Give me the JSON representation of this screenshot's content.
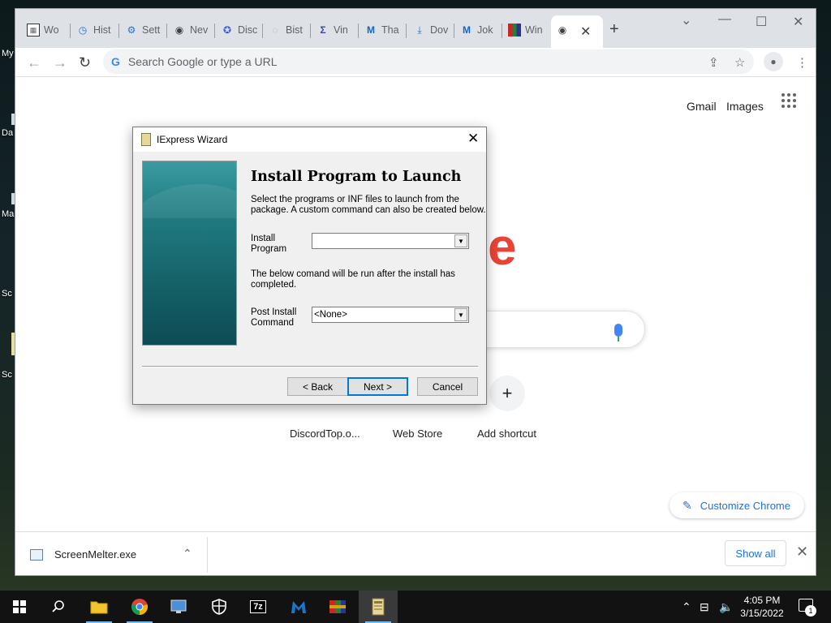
{
  "desktop": {
    "icons": [
      "My",
      "Da",
      "Ma",
      "Sc",
      "Sc"
    ]
  },
  "chrome": {
    "tabs": [
      {
        "label": "Wo",
        "icon": "sheets-icon"
      },
      {
        "label": "Hist",
        "icon": "history-icon"
      },
      {
        "label": "Sett",
        "icon": "settings-icon"
      },
      {
        "label": "Nev",
        "icon": "chrome-icon"
      },
      {
        "label": "Disc",
        "icon": "discord-icon"
      },
      {
        "label": "Bist",
        "icon": "bistro-icon"
      },
      {
        "label": "Vin",
        "icon": "sigma-icon"
      },
      {
        "label": "Tha",
        "icon": "malwarebytes-icon"
      },
      {
        "label": "Dov",
        "icon": "download-icon"
      },
      {
        "label": "Jok",
        "icon": "malwarebytes-icon"
      },
      {
        "label": "Win",
        "icon": "winrar-icon"
      }
    ],
    "active_tab_icon": "chrome-icon",
    "omnibox_placeholder": "Search Google or type a URL",
    "ntp": {
      "gmail": "Gmail",
      "images": "Images",
      "logo_letter": "e",
      "shortcuts": [
        "DiscordTop.o...",
        "Web Store",
        "Add shortcut"
      ],
      "customize": "Customize Chrome"
    },
    "download": {
      "filename": "ScreenMelter.exe",
      "show_all": "Show all"
    }
  },
  "dialog": {
    "title": "IExpress Wizard",
    "heading": "Install Program to Launch",
    "intro_line1": "Select the programs or INF files to launch from the",
    "intro_line2": "package.  A custom command can also be created below.",
    "install_label1": "Install",
    "install_label2": "Program",
    "install_value": "",
    "after_line1": "The below comand will be run after the install has",
    "after_line2": "completed.",
    "post_label1": "Post Install",
    "post_label2": "Command",
    "post_value": "<None>",
    "back": "< Back",
    "next": "Next >",
    "cancel": "Cancel"
  },
  "taskbar": {
    "apps": [
      "start-icon",
      "search-icon",
      "file-explorer-icon",
      "chrome-icon",
      "control-panel-icon",
      "windows-security-icon",
      "7zip-icon",
      "malwarebytes-icon",
      "winrar-icon",
      "iexpress-icon"
    ],
    "sevenzip_label": "7z",
    "time": "4:05 PM",
    "date": "3/15/2022",
    "notifications": "1"
  }
}
